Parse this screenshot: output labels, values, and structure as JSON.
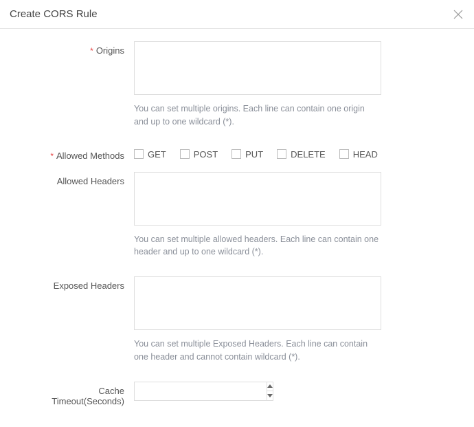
{
  "dialog": {
    "title": "Create CORS Rule"
  },
  "form": {
    "origins": {
      "label": "Origins",
      "value": "",
      "hint": "You can set multiple origins. Each line can contain one origin and up to one wildcard (*)."
    },
    "allowed_methods": {
      "label": "Allowed Methods",
      "options": [
        {
          "label": "GET",
          "checked": false
        },
        {
          "label": "POST",
          "checked": false
        },
        {
          "label": "PUT",
          "checked": false
        },
        {
          "label": "DELETE",
          "checked": false
        },
        {
          "label": "HEAD",
          "checked": false
        }
      ]
    },
    "allowed_headers": {
      "label": "Allowed Headers",
      "value": "",
      "hint": "You can set multiple allowed headers. Each line can contain one header and up to one wildcard (*)."
    },
    "exposed_headers": {
      "label": "Exposed Headers",
      "value": "",
      "hint": "You can set multiple Exposed Headers. Each line can contain one header and cannot contain wildcard (*)."
    },
    "cache_timeout": {
      "label": "Cache Timeout(Seconds)",
      "value": ""
    }
  }
}
